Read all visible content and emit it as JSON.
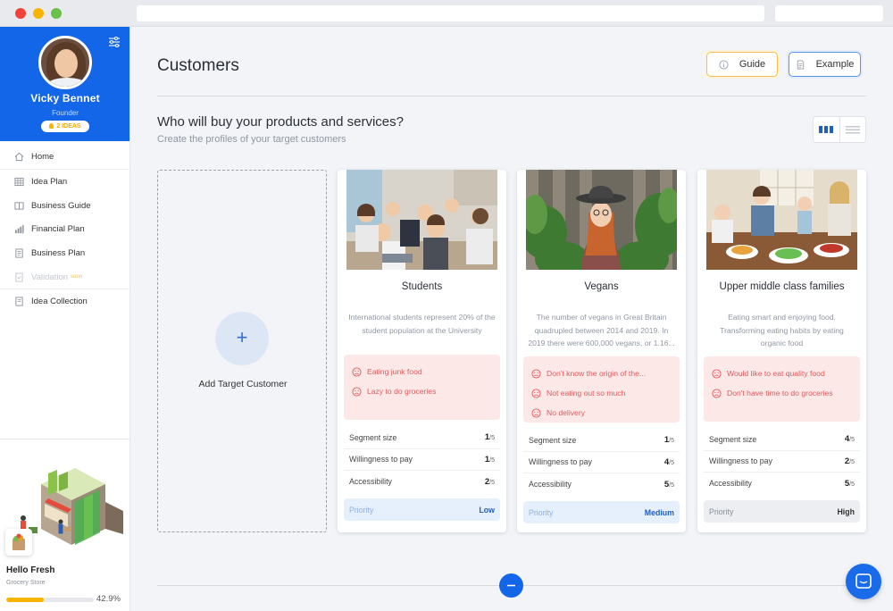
{
  "profile": {
    "name": "Vicky Bennet",
    "role": "Founder",
    "ideas_badge": "2 IDEAS"
  },
  "nav": {
    "items": [
      {
        "label": "Home"
      },
      {
        "label": "Idea Plan"
      },
      {
        "label": "Business Guide"
      },
      {
        "label": "Financial Plan"
      },
      {
        "label": "Business Plan"
      },
      {
        "label": "Validation",
        "tag": "soon"
      },
      {
        "label": "Idea Collection"
      }
    ]
  },
  "project": {
    "name": "Hello Fresh",
    "type": "Grocery Store",
    "progress_label": "42.9%",
    "progress": 0.429
  },
  "header": {
    "title": "Customers",
    "guide_label": "Guide",
    "example_label": "Example"
  },
  "section": {
    "title": "Who will buy your products and services?",
    "subtitle": "Create the profiles of your target customers"
  },
  "add_card": {
    "label": "Add Target Customer",
    "plus": "+"
  },
  "metric_labels": {
    "segment": "Segment size",
    "willingness": "Willingness to pay",
    "access": "Accessibility",
    "priority": "Priority",
    "scale": "/5"
  },
  "cards": [
    {
      "name": "Students",
      "description": "International students represent 20% of the student population at the University",
      "pains": [
        "Eating junk food",
        "Lazy to do groceries"
      ],
      "segment": "1",
      "willingness": "1",
      "access": "2",
      "priority": "Low"
    },
    {
      "name": "Vegans",
      "description": "The number of vegans in Great Britain quadrupled between 2014 and 2019. In 2019 there were 600,000 vegans, or 1.16...",
      "pains": [
        "Don't know the origin of the...",
        "Not eating out so much",
        "No delivery"
      ],
      "segment": "1",
      "willingness": "4",
      "access": "5",
      "priority": "Medium"
    },
    {
      "name": "Upper middle class families",
      "description": "Eating smart and enjoying food. Transforming eating habits by eating organic food",
      "pains": [
        "Would like to eat quality food",
        "Don't have time to do groceries"
      ],
      "segment": "4",
      "willingness": "2",
      "access": "5",
      "priority": "High"
    }
  ],
  "colors": {
    "brand": "#1466e8",
    "pain_bg": "#fde8e8",
    "pain_text": "#e0595a",
    "progress": "#f7b500"
  }
}
